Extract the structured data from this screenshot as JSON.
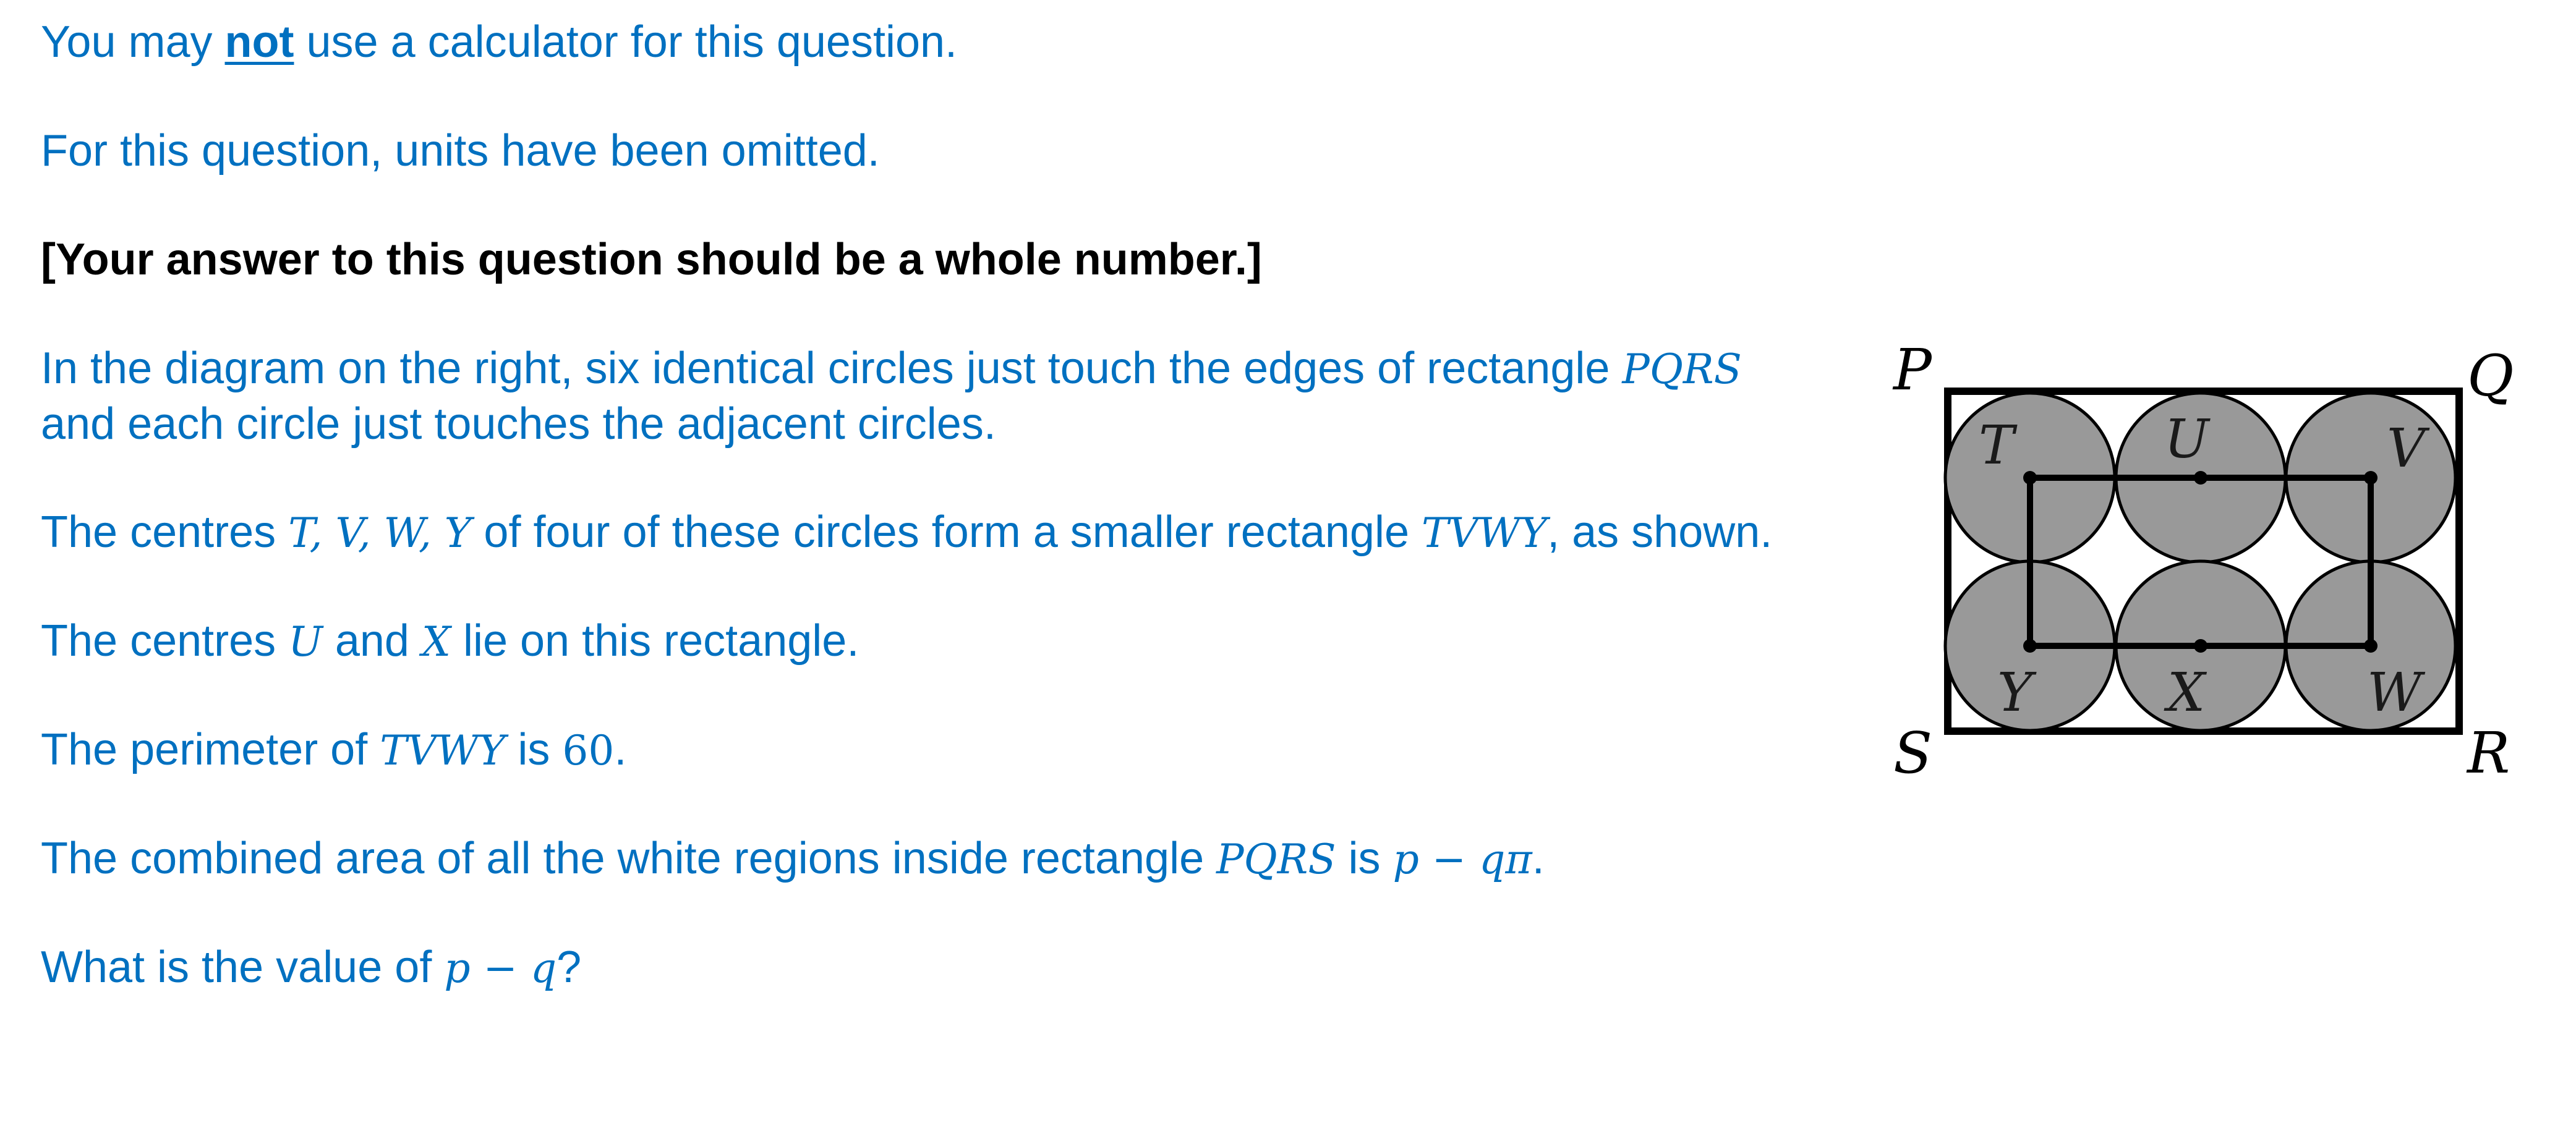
{
  "question": {
    "line1": {
      "before": "You may ",
      "emphasis": "not",
      "after": " use a calculator for this question."
    },
    "line2": "For this question, units have been omitted.",
    "line3": "[Your answer to this question should be a whole number.]",
    "para4": {
      "text_a": "In the diagram on the right, six identical circles just touch the edges of rectangle ",
      "math_a": "PQRS",
      "text_b": "and each circle just touches the adjacent circles."
    },
    "para5": {
      "text_a": "The centres ",
      "math_a": "T, V, W, Y",
      "text_b": " of four of these circles form a smaller rectangle ",
      "math_b": "TVWY",
      "text_c": ", as shown."
    },
    "para6": {
      "text_a": "The centres ",
      "math_a": "U",
      "text_b": " and ",
      "math_b": "X",
      "text_c": " lie on this rectangle."
    },
    "para7": {
      "text_a": "The perimeter of ",
      "math_a": "TVWY",
      "text_b": " is ",
      "num_a": "60",
      "text_c": "."
    },
    "para8": {
      "text_a": "The combined area of all the white regions inside rectangle ",
      "math_a": "PQRS",
      "text_b": " is ",
      "math_b": "p − qπ",
      "text_c": "."
    },
    "para9": {
      "text_a": "What is the value of ",
      "math_a": "p − q",
      "text_b": "?"
    }
  },
  "diagram": {
    "corner_labels": {
      "top_left": "P",
      "top_right": "Q",
      "bottom_right": "R",
      "bottom_left": "S"
    },
    "center_labels": {
      "top_left": "T",
      "top_middle": "U",
      "top_right": "V",
      "bottom_left": "Y",
      "bottom_middle": "X",
      "bottom_right": "W"
    },
    "colors": {
      "circle_fill": "#999999",
      "outline": "#000000"
    }
  }
}
